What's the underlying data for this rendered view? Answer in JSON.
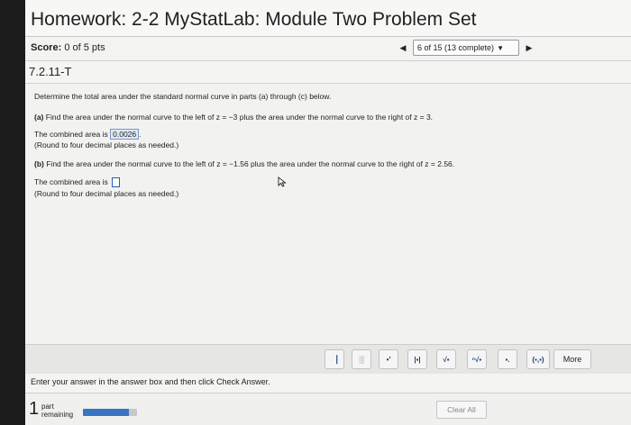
{
  "header": {
    "title": "Homework: 2-2 MyStatLab: Module Two Problem Set"
  },
  "score": {
    "label": "Score:",
    "value": "0 of 5 pts"
  },
  "nav": {
    "prev_icon": "triangle-left-icon",
    "question_select": "6 of 15 (13 complete)",
    "next_icon": "triangle-right-icon"
  },
  "question": {
    "id": "7.2.11-T",
    "intro": "Determine the total area under the standard normal curve in parts (a) through (c) below.",
    "part_a": {
      "label": "(a)",
      "text": "Find the area under the normal curve to the left of z = −3 plus the area under the normal curve to the right of z = 3.",
      "answer_prefix": "The combined area is",
      "answer_value": "0.0026",
      "answer_suffix": ".",
      "rounding": "(Round to four decimal places as needed.)"
    },
    "part_b": {
      "label": "(b)",
      "text": "Find the area under the normal curve to the left of z = −1.56 plus the area under the normal curve to the right of z = 2.56.",
      "answer_prefix": "The combined area is",
      "rounding": "(Round to four decimal places as needed.)"
    }
  },
  "toolbar": {
    "tools": [
      "fraction-icon",
      "mixed-number-icon",
      "exponent-icon",
      "absolute-value-icon",
      "square-root-icon",
      "nth-root-icon",
      "decimal-icon",
      "interval-icon"
    ],
    "tool_glyphs": [
      "▕",
      "░",
      "•′",
      "|▪|",
      "√▪",
      "ⁿ√▪",
      "▪.",
      "(▪,▪)"
    ],
    "more_label": "More"
  },
  "instruction": "Enter your answer in the answer box and then click Check Answer.",
  "footer": {
    "parts_count": "1",
    "parts_label_line1": "part",
    "parts_label_line2": "remaining",
    "progress_fraction": 0.85,
    "clear_all_label": "Clear All"
  },
  "colors": {
    "accent": "#3a73c4",
    "answer_highlight": "#dfe8f7"
  }
}
